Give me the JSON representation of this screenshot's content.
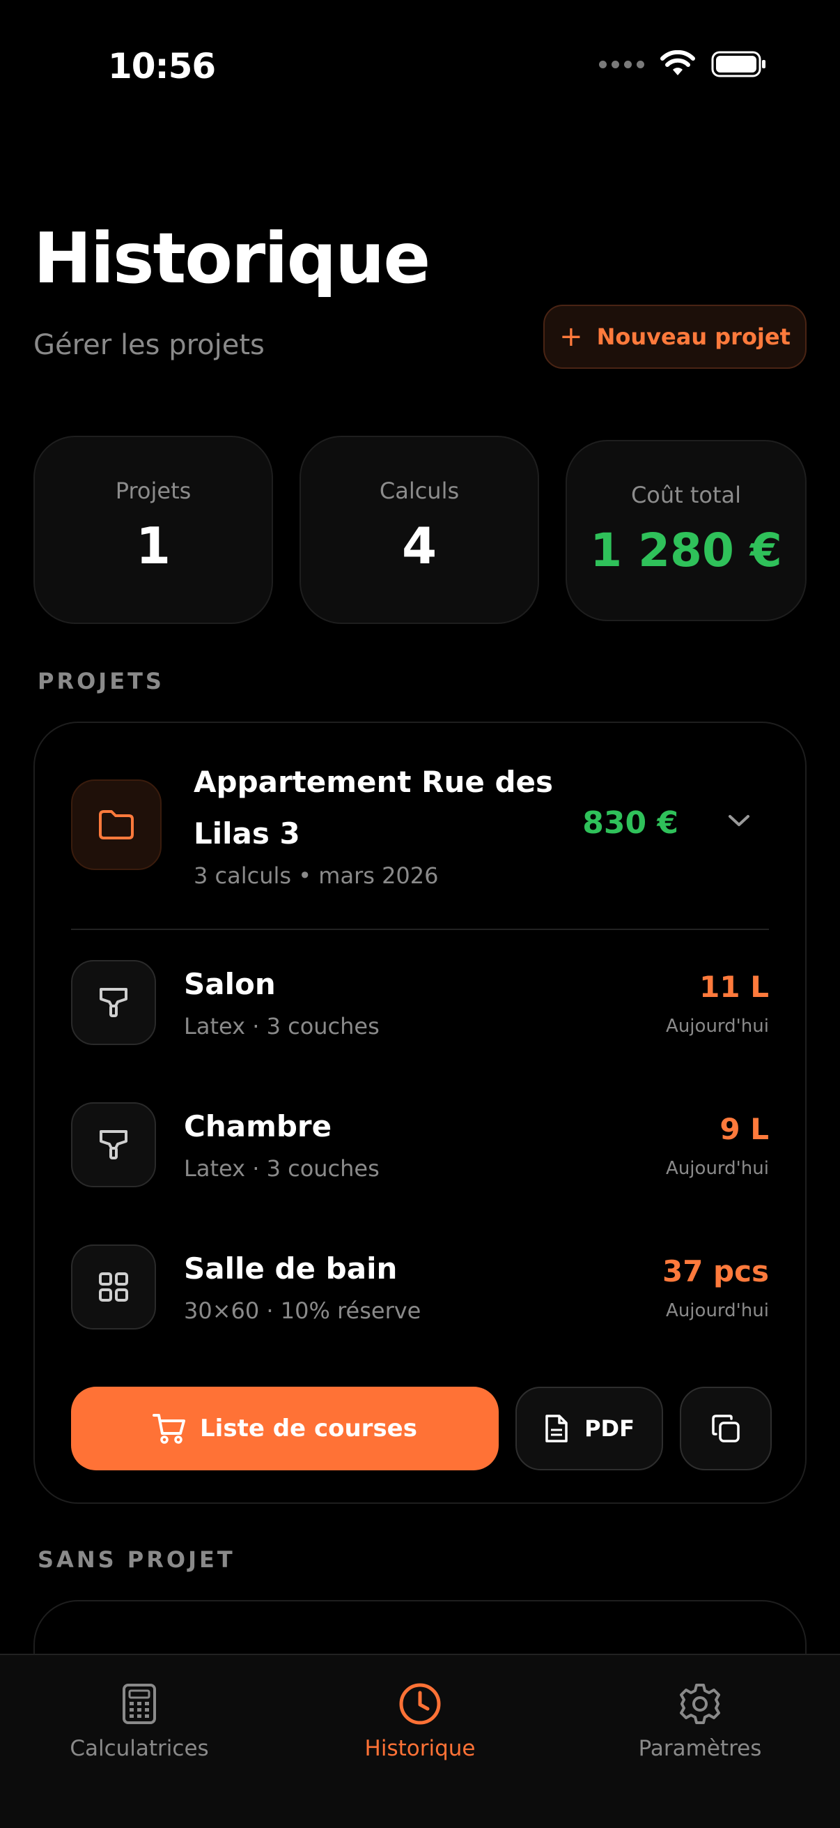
{
  "status_bar": {
    "time": "10:56"
  },
  "header": {
    "title": "Historique",
    "subtitle": "Gérer les projets",
    "new_project_label": "Nouveau projet"
  },
  "stats": [
    {
      "label": "Projets",
      "value": "1"
    },
    {
      "label": "Calculs",
      "value": "4"
    },
    {
      "label": "Coût total",
      "value": "1 280 €"
    }
  ],
  "sections": {
    "projects": "PROJETS",
    "no_project": "SANS PROJET"
  },
  "project": {
    "name": "Appartement Rue des Lilas 3",
    "meta": "3 calculs • mars 2026",
    "total": "830 €",
    "calculations": [
      {
        "name": "Salon",
        "detail": "Latex · 3 couches",
        "quantity": "11 L",
        "date": "Aujourd'hui",
        "icon": "paint-roller-icon"
      },
      {
        "name": "Chambre",
        "detail": "Latex · 3 couches",
        "quantity": "9 L",
        "date": "Aujourd'hui",
        "icon": "paint-roller-icon"
      },
      {
        "name": "Salle de bain",
        "detail": "30×60 · 10% réserve",
        "quantity": "37 pcs",
        "date": "Aujourd'hui",
        "icon": "tiles-grid-icon"
      }
    ],
    "actions": {
      "shopping_list": "Liste de courses",
      "pdf": "PDF"
    }
  },
  "tabs": [
    {
      "label": "Calculatrices",
      "icon": "calculator-icon",
      "active": false
    },
    {
      "label": "Historique",
      "icon": "clock-icon",
      "active": true
    },
    {
      "label": "Paramètres",
      "icon": "gear-icon",
      "active": false
    }
  ],
  "colors": {
    "accent": "#ff7236",
    "positive": "#2fc15a",
    "background": "#000000"
  }
}
